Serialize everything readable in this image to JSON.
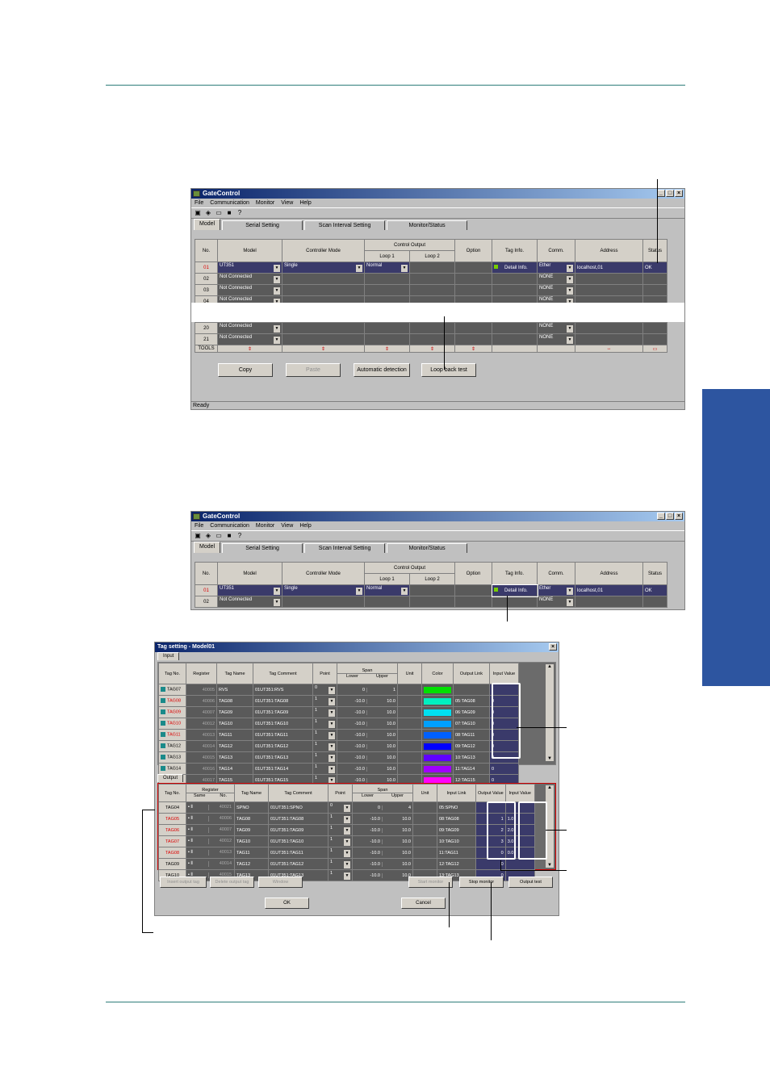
{
  "window": {
    "title": "GateControl",
    "menu": [
      "File",
      "Communication",
      "Monitor",
      "View",
      "Help"
    ],
    "tabs": [
      "Model",
      "Serial Setting",
      "Scan Interval Setting",
      "Monitor/Status"
    ],
    "status": "Ready"
  },
  "model_table": {
    "headers": {
      "no": "No.",
      "model": "Model",
      "mode": "Controller Mode",
      "control_output": "Control Output",
      "loop1": "Loop 1",
      "loop2": "Loop 2",
      "option": "Option",
      "tag": "Tag Info.",
      "comm": "Comm.",
      "address": "Address",
      "status": "Status"
    },
    "rows": [
      {
        "no": "01",
        "model": "UT351",
        "mode": "Single",
        "loop1": "Normal",
        "tag": "Detail Info.",
        "comm": "Ether",
        "address": "localhost,01",
        "status": "OK"
      },
      {
        "no": "02",
        "model": "Not Connected",
        "comm": "NONE"
      },
      {
        "no": "03",
        "model": "Not Connected",
        "comm": "NONE"
      },
      {
        "no": "04",
        "model": "Not Connected",
        "comm": "NONE"
      }
    ],
    "tail_rows": [
      {
        "no": "20",
        "model": "Not Connected",
        "comm": "NONE"
      },
      {
        "no": "21",
        "model": "Not Connected",
        "comm": "NONE"
      }
    ],
    "footer_label": "TOOLS"
  },
  "buttons1": {
    "copy": "Copy",
    "paste": "Paste",
    "auto": "Automatic detection",
    "loop": "Loop back test"
  },
  "dialog": {
    "title": "Tag setting - Model01",
    "input_tab": "Input",
    "output_tab": "Output",
    "input_headers": [
      "Tag No.",
      "Register",
      "Tag Name",
      "Tag Comment",
      "Point",
      "Span",
      "Lower",
      "Upper",
      "Unit",
      "Color",
      "Output Link",
      "Input Value"
    ],
    "input_rows": [
      {
        "tag": "TAG07",
        "reg": "40005",
        "name": "RVS",
        "comment": "01UT351:RVS",
        "point": "0",
        "lower": "0",
        "upper": "1",
        "color": "#00e000",
        "link": "",
        "value": ""
      },
      {
        "tag": "TAG08",
        "reg": "40006",
        "name": "TAG08",
        "comment": "01UT351:TAG08",
        "point": "1",
        "lower": "-10.0",
        "upper": "10.0",
        "color": "#00f0c0",
        "link": "05:TAG08",
        "value": "0"
      },
      {
        "tag": "TAG09",
        "reg": "40007",
        "name": "TAG09",
        "comment": "01UT351:TAG09",
        "point": "1",
        "lower": "-10.0",
        "upper": "10.0",
        "color": "#00e0f0",
        "link": "06:TAG09",
        "value": "0"
      },
      {
        "tag": "TAG10",
        "reg": "40012",
        "name": "TAG10",
        "comment": "01UT351:TAG10",
        "point": "1",
        "lower": "-10.0",
        "upper": "10.0",
        "color": "#00a0ff",
        "link": "07:TAG10",
        "value": "0"
      },
      {
        "tag": "TAG11",
        "reg": "40013",
        "name": "TAG11",
        "comment": "01UT351:TAG11",
        "point": "1",
        "lower": "-10.0",
        "upper": "10.0",
        "color": "#0060ff",
        "link": "08:TAG11",
        "value": "0"
      },
      {
        "tag": "TAG12",
        "reg": "40014",
        "name": "TAG12",
        "comment": "01UT351:TAG12",
        "point": "1",
        "lower": "-10.0",
        "upper": "10.0",
        "color": "#0000ff",
        "link": "09:TAG12",
        "value": "0"
      },
      {
        "tag": "TAG13",
        "reg": "40015",
        "name": "TAG13",
        "comment": "01UT351:TAG13",
        "point": "1",
        "lower": "-10.0",
        "upper": "10.0",
        "color": "#6000ff",
        "link": "10:TAG13",
        "value": "0"
      },
      {
        "tag": "TAG14",
        "reg": "40016",
        "name": "TAG14",
        "comment": "01UT351:TAG14",
        "point": "1",
        "lower": "-10.0",
        "upper": "10.0",
        "color": "#a000ff",
        "link": "11:TAG14",
        "value": "0"
      },
      {
        "tag": "TAG15",
        "reg": "40017",
        "name": "TAG15",
        "comment": "01UT351:TAG15",
        "point": "1",
        "lower": "-10.0",
        "upper": "10.0",
        "color": "#ff00ff",
        "link": "12:TAG15",
        "value": "0"
      }
    ],
    "output_headers": [
      "Tag No.",
      "Register",
      "Same",
      "No.",
      "Tag Name",
      "Tag Comment",
      "Point",
      "Span",
      "Lower",
      "Upper",
      "Unit",
      "Input Link",
      "Output Value",
      "Input Value"
    ],
    "output_rows": [
      {
        "tag": "TAG04",
        "reg": "40021",
        "name": "SPNO",
        "comment": "01UT351:SPNO",
        "point": "0",
        "lower": "0",
        "upper": "4",
        "link": "05:SPNO",
        "out": "",
        "in": ""
      },
      {
        "tag": "TAG05",
        "reg": "40006",
        "name": "TAG08",
        "comment": "01UT351:TAG08",
        "point": "1",
        "lower": "-10.0",
        "upper": "10.0",
        "link": "08:TAG08",
        "out": "1",
        "in": "1.0"
      },
      {
        "tag": "TAG06",
        "reg": "40007",
        "name": "TAG09",
        "comment": "01UT351:TAG09",
        "point": "1",
        "lower": "-10.0",
        "upper": "10.0",
        "link": "09:TAG09",
        "out": "2",
        "in": "2.0"
      },
      {
        "tag": "TAG07",
        "reg": "40012",
        "name": "TAG10",
        "comment": "01UT351:TAG10",
        "point": "1",
        "lower": "-10.0",
        "upper": "10.0",
        "link": "10:TAG10",
        "out": "3",
        "in": "3.0"
      },
      {
        "tag": "TAG08",
        "reg": "40013",
        "name": "TAG11",
        "comment": "01UT351:TAG11",
        "point": "1",
        "lower": "-10.0",
        "upper": "10.0",
        "link": "11:TAG11",
        "out": "0",
        "in": "0.0"
      },
      {
        "tag": "TAG09",
        "reg": "40014",
        "name": "TAG12",
        "comment": "01UT351:TAG12",
        "point": "1",
        "lower": "-10.0",
        "upper": "10.0",
        "link": "12:TAG12",
        "out": "0",
        "in": ""
      },
      {
        "tag": "TAG10",
        "reg": "40015",
        "name": "TAG13",
        "comment": "01UT351:TAG13",
        "point": "1",
        "lower": "-10.0",
        "upper": "10.0",
        "link": "13:TAG13",
        "out": "0",
        "in": ""
      }
    ],
    "buttons": {
      "insert": "Insert output tag",
      "delete": "Delete output tag",
      "window": "Window",
      "start": "Start monitor",
      "stop": "Stop monitor",
      "output_test": "Output test",
      "ok": "OK",
      "cancel": "Cancel"
    }
  }
}
